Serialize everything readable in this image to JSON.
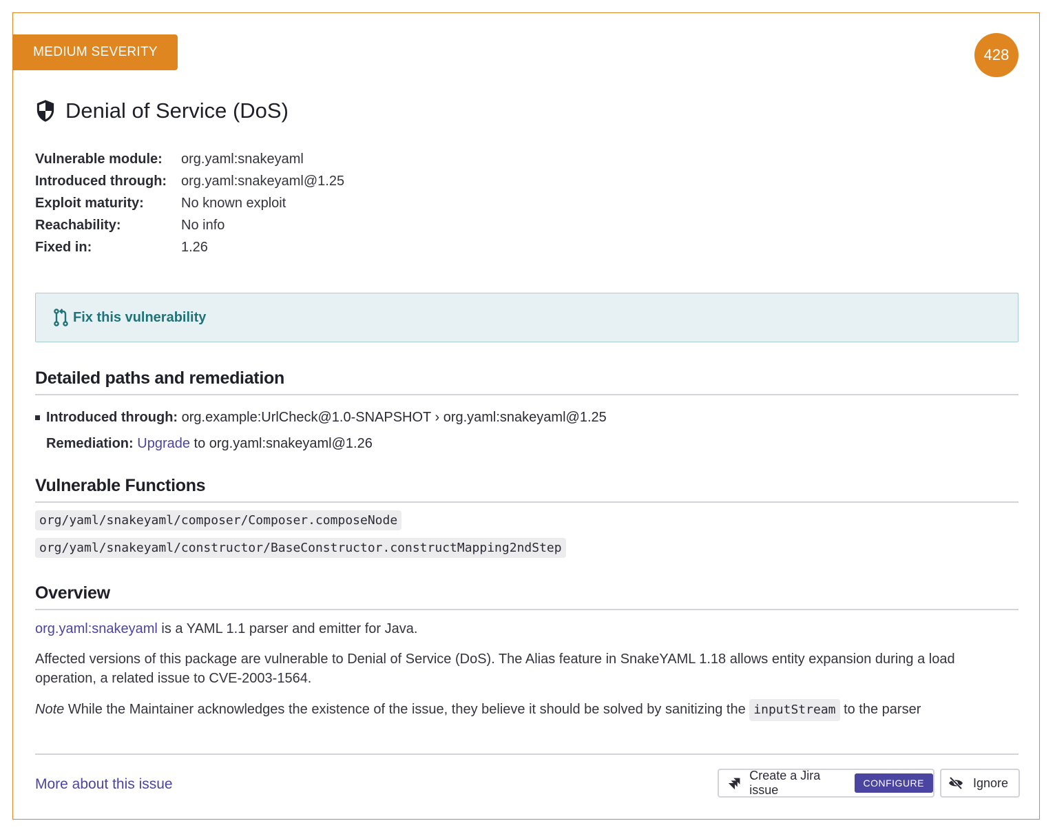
{
  "severity": {
    "label": "MEDIUM SEVERITY",
    "color": "#df8620"
  },
  "score": "428",
  "title": {
    "icon": "shield-icon",
    "text": "Denial of Service (DoS)"
  },
  "meta": [
    {
      "label": "Vulnerable module:",
      "value": "org.yaml:snakeyaml"
    },
    {
      "label": "Introduced through:",
      "value": "org.yaml:snakeyaml@1.25"
    },
    {
      "label": "Exploit maturity:",
      "value": "No known exploit"
    },
    {
      "label": "Reachability:",
      "value": "No info"
    },
    {
      "label": "Fixed in:",
      "value": "1.26"
    }
  ],
  "fix": {
    "icon": "pull-request-icon",
    "label": "Fix this vulnerability"
  },
  "paths": {
    "heading": "Detailed paths and remediation",
    "introduced_label": "Introduced through:",
    "introduced_value": "org.example:UrlCheck@1.0-SNAPSHOT › org.yaml:snakeyaml@1.25",
    "remediation_label": "Remediation:",
    "remediation_link": "Upgrade",
    "remediation_rest": "to org.yaml:snakeyaml@1.26"
  },
  "functions": {
    "heading": "Vulnerable Functions",
    "items": [
      "org/yaml/snakeyaml/composer/Composer.composeNode",
      "org/yaml/snakeyaml/constructor/BaseConstructor.constructMapping2ndStep"
    ]
  },
  "overview": {
    "heading": "Overview",
    "p1_link": "org.yaml:snakeyaml",
    "p1_rest": "is a YAML 1.1 parser and emitter for Java.",
    "p2": "Affected versions of this package are vulnerable to Denial of Service (DoS). The Alias feature in SnakeYAML 1.18 allows entity expansion during a load operation, a related issue to CVE-2003-1564.",
    "p3_note": "Note",
    "p3_text": "While the Maintainer acknowledges the existence of the issue, they believe it should be solved by sanitizing the",
    "p3_code": "inputStream",
    "p3_end": "to the parser"
  },
  "footer": {
    "more_link": "More about this issue",
    "jira_label": "Create a Jira issue",
    "configure_label": "CONFIGURE",
    "ignore_label": "Ignore"
  },
  "colors": {
    "accent": "#df8620",
    "link": "#4b45a1",
    "fix_text": "#1f7277",
    "fix_bg": "#e7f1f3"
  }
}
